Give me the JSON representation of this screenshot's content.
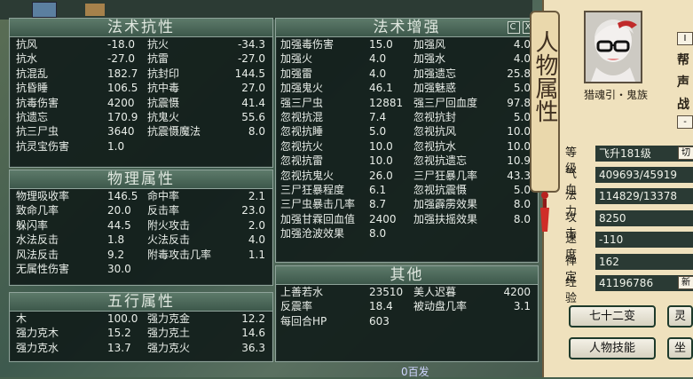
{
  "magic_resist": {
    "title": "法术抗性",
    "rows": [
      [
        "抗风",
        "-18.0",
        "抗火",
        "-34.3"
      ],
      [
        "抗水",
        "-27.0",
        "抗雷",
        "-27.0"
      ],
      [
        "抗混乱",
        "182.7",
        "抗封印",
        "144.5"
      ],
      [
        "抗昏睡",
        "106.5",
        "抗中毒",
        "27.0"
      ],
      [
        "抗毒伤害",
        "4200",
        "抗震慑",
        "41.4"
      ],
      [
        "抗遗忘",
        "170.9",
        "抗鬼火",
        "55.6"
      ],
      [
        "抗三尸虫",
        "3640",
        "抗震慑魔法",
        "8.0"
      ],
      [
        "抗灵宝伤害",
        "1.0",
        "",
        ""
      ]
    ]
  },
  "physical": {
    "title": "物理属性",
    "rows": [
      [
        "物理吸收率",
        "146.5",
        "命中率",
        "2.1"
      ],
      [
        "致命几率",
        "20.0",
        "反击率",
        "23.0"
      ],
      [
        "躲闪率",
        "44.5",
        "附火攻击",
        "2.0"
      ],
      [
        "水法反击",
        "1.8",
        "火法反击",
        "4.0"
      ],
      [
        "风法反击",
        "9.2",
        "附毒攻击几率",
        "1.1"
      ],
      [
        "无属性伤害",
        "30.0",
        "",
        ""
      ]
    ]
  },
  "five_elements": {
    "title": "五行属性",
    "rows": [
      [
        "木",
        "100.0",
        "强力克金",
        "12.2"
      ],
      [
        "强力克木",
        "15.2",
        "强力克土",
        "14.6"
      ],
      [
        "强力克水",
        "13.7",
        "强力克火",
        "36.3"
      ]
    ]
  },
  "magic_boost": {
    "title": "法术增强",
    "btn_a": "C",
    "btn_b": "X",
    "rows": [
      [
        "加强毒伤害",
        "15.0",
        "加强风",
        "4.0"
      ],
      [
        "加强火",
        "4.0",
        "加强水",
        "4.0"
      ],
      [
        "加强雷",
        "4.0",
        "加强遗忘",
        "25.8"
      ],
      [
        "加强鬼火",
        "46.1",
        "加强魅惑",
        "5.0"
      ],
      [
        "强三尸虫",
        "12881",
        "强三尸回血度",
        "97.8"
      ],
      [
        "忽视抗混",
        "7.4",
        "忽视抗封",
        "5.0"
      ],
      [
        "忽视抗睡",
        "5.0",
        "忽视抗风",
        "10.0"
      ],
      [
        "忽视抗火",
        "10.0",
        "忽视抗水",
        "10.0"
      ],
      [
        "忽视抗雷",
        "10.0",
        "忽视抗遗忘",
        "10.9"
      ],
      [
        "忽视抗鬼火",
        "26.0",
        "三尸狂暴几率",
        "43.3"
      ],
      [
        "三尸狂暴程度",
        "6.1",
        "忽视抗震慑",
        "5.0"
      ],
      [
        "三尸虫暴击几率",
        "8.7",
        "加强霹雳效果",
        "8.0"
      ],
      [
        "加强甘霖回血值",
        "2400",
        "加强扶摇效果",
        "8.0"
      ],
      [
        "加强沧波效果",
        "8.0",
        "",
        ""
      ]
    ]
  },
  "other": {
    "title": "其他",
    "rows": [
      [
        "上善若水",
        "23510",
        "美人迟暮",
        "4200"
      ],
      [
        "反震率",
        "18.4",
        "被动盘几率",
        "3.1"
      ],
      [
        "每回合HP",
        "603",
        "",
        ""
      ]
    ]
  },
  "char": {
    "scroll_title": "人物属性",
    "name": "猎魂引・鬼族",
    "side_chars": [
      "帮",
      "声",
      "战"
    ],
    "side_btns": [
      "I",
      "-"
    ],
    "stats": [
      {
        "label": "等级",
        "value": "飞升181级"
      },
      {
        "label": "气血",
        "value": "409693/45919"
      },
      {
        "label": "法力",
        "value": "114829/13378"
      },
      {
        "label": "攻击",
        "value": "8250"
      },
      {
        "label": "速度",
        "value": "-110"
      },
      {
        "label": "禅定",
        "value": "162"
      },
      {
        "label": "经验",
        "value": "41196786"
      }
    ],
    "level_btn": "切",
    "exp_btn": "新",
    "buttons": [
      "七十二变",
      "人物技能"
    ],
    "buttons_right": [
      "灵",
      "坐"
    ],
    "footer": "0百发"
  }
}
